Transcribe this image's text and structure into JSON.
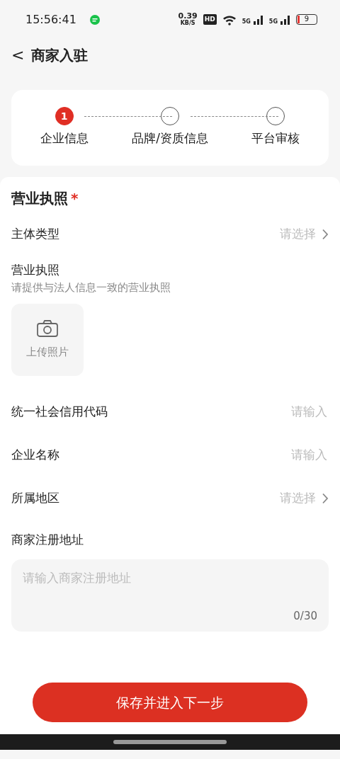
{
  "status_bar": {
    "time": "15:56:41",
    "net_speed": "0.39",
    "net_unit": "KB/S",
    "hd": "HD",
    "signals": [
      "5G",
      "5G"
    ],
    "battery": "9"
  },
  "header": {
    "back": "<",
    "title": "商家入驻"
  },
  "steps": [
    {
      "label": "企业信息",
      "active": true,
      "number": "1"
    },
    {
      "label": "品牌/资质信息",
      "active": false
    },
    {
      "label": "平台审核",
      "active": false
    }
  ],
  "form": [
    {
      "kind": "section",
      "label": "营业执照",
      "required": "*"
    },
    {
      "kind": "select",
      "label": "主体类型",
      "placeholder": "请选择"
    },
    {
      "kind": "upload",
      "label": "营业执照",
      "hint": "请提供与法人信息一致的营业执照",
      "button": "上传照片"
    },
    {
      "kind": "input",
      "label": "统一社会信用代码",
      "placeholder": "请输入"
    },
    {
      "kind": "input",
      "label": "企业名称",
      "placeholder": "请输入"
    },
    {
      "kind": "select",
      "label": "所属地区",
      "placeholder": "请选择"
    },
    {
      "kind": "textarea",
      "label": "商家注册地址",
      "placeholder": "请输入商家注册地址",
      "counter": "0/30"
    }
  ],
  "submit": "保存并进入下一步"
}
